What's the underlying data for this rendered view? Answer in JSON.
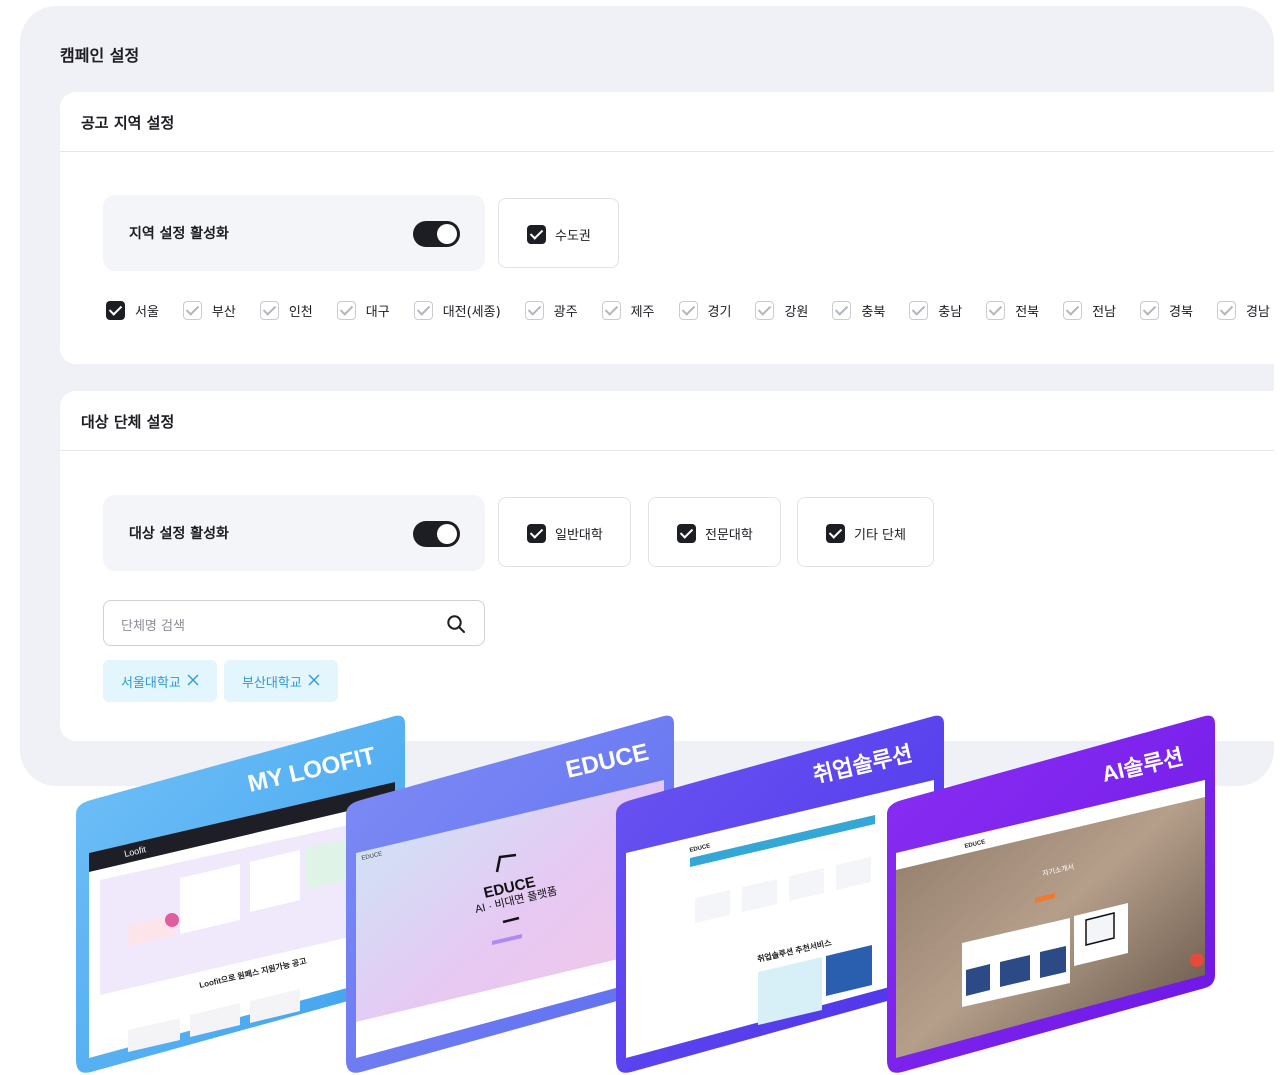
{
  "campaign": {
    "title": "캠페인 설정",
    "region": {
      "heading": "공고 지역 설정",
      "toggle_label": "지역 설정 활성화",
      "toggle_on": true,
      "group_label": "수도권",
      "group_checked": true,
      "items": [
        {
          "label": "서울",
          "checked": true
        },
        {
          "label": "부산",
          "checked": false
        },
        {
          "label": "인천",
          "checked": false
        },
        {
          "label": "대구",
          "checked": false
        },
        {
          "label": "대전(세종)",
          "checked": false
        },
        {
          "label": "광주",
          "checked": false
        },
        {
          "label": "제주",
          "checked": false
        },
        {
          "label": "경기",
          "checked": false
        },
        {
          "label": "강원",
          "checked": false
        },
        {
          "label": "충북",
          "checked": false
        },
        {
          "label": "충남",
          "checked": false
        },
        {
          "label": "전북",
          "checked": false
        },
        {
          "label": "전남",
          "checked": false
        },
        {
          "label": "경북",
          "checked": false
        },
        {
          "label": "경남",
          "checked": false
        }
      ]
    },
    "target": {
      "heading": "대상 단체 설정",
      "toggle_label": "대상 설정 활성화",
      "toggle_on": true,
      "options": [
        {
          "label": "일반대학",
          "checked": true
        },
        {
          "label": "전문대학",
          "checked": true
        },
        {
          "label": "기타 단체",
          "checked": true
        }
      ],
      "search_placeholder": "단체명 검색",
      "tags": [
        {
          "label": "서울대학교"
        },
        {
          "label": "부산대학교"
        }
      ]
    }
  },
  "brands": [
    {
      "label": "MY LOOFIT",
      "color": "#5ab2f3"
    },
    {
      "label": "EDUCE",
      "color": "#6a78f2"
    },
    {
      "label": "취업솔루션",
      "color": "#5e46ee"
    },
    {
      "label": "AI솔루션",
      "color": "#7a22ee"
    }
  ],
  "screens": {
    "loofit": {
      "logo": "Loofit",
      "heading": "Loofit으로 원페스 지원가능 공고"
    },
    "educe": {
      "logo": "EDUCE",
      "hero": "EDUCE",
      "sub": "AI · 비대면 플랫폼"
    },
    "job": {
      "logo": "EDUCE",
      "heading": "취업솔루션 추천서비스"
    },
    "ai": {
      "logo": "EDUCE",
      "heading": "자기소개서"
    }
  }
}
